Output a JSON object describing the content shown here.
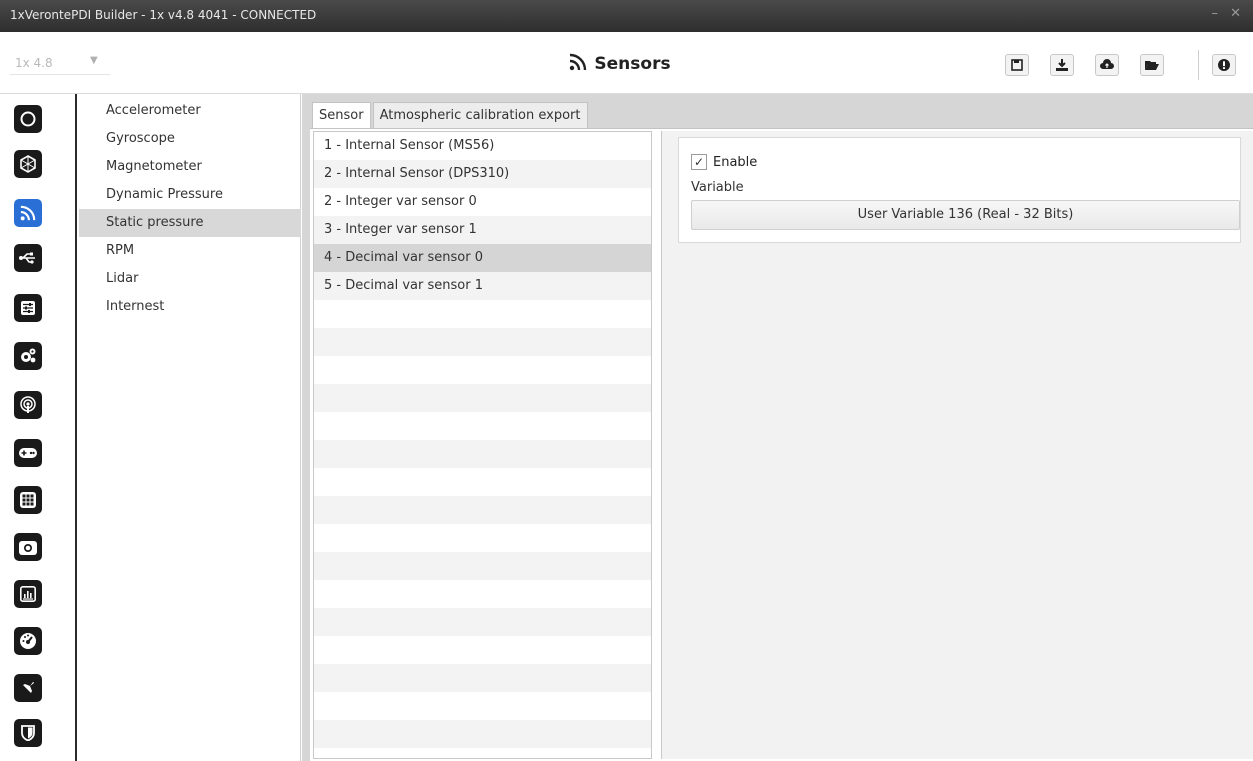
{
  "window": {
    "title": "1xVerontePDI Builder - 1x v4.8 4041 - CONNECTED",
    "controls": "– ✕"
  },
  "header": {
    "version": "1x 4.8",
    "title": "Sensors",
    "toolbar": [
      {
        "name": "save-icon",
        "glyph": "save"
      },
      {
        "name": "download-icon",
        "glyph": "download"
      },
      {
        "name": "cloud-upload-icon",
        "glyph": "cloud"
      },
      {
        "name": "folder-open-icon",
        "glyph": "folder"
      },
      {
        "name": "info-icon",
        "glyph": "info"
      }
    ]
  },
  "rail": {
    "items": [
      {
        "name": "power-icon",
        "active": false
      },
      {
        "name": "network-icon",
        "active": false
      },
      {
        "name": "sensors-icon",
        "active": true
      },
      {
        "name": "usb-icon",
        "active": false
      },
      {
        "name": "sliders-icon",
        "active": false
      },
      {
        "name": "gears-icon",
        "active": false
      },
      {
        "name": "podcast-icon",
        "active": false
      },
      {
        "name": "gamepad-icon",
        "active": false
      },
      {
        "name": "grid-icon",
        "active": false
      },
      {
        "name": "camera-icon",
        "active": false
      },
      {
        "name": "chart-icon",
        "active": false
      },
      {
        "name": "gauge-icon",
        "active": false
      },
      {
        "name": "plane-icon",
        "active": false
      },
      {
        "name": "shield-icon",
        "active": false
      }
    ],
    "active_color": "#2a6fd6"
  },
  "categories": [
    "Accelerometer",
    "Gyroscope",
    "Magnetometer",
    "Dynamic Pressure",
    "Static pressure",
    "RPM",
    "Lidar",
    "Internest"
  ],
  "selected_category": "Static pressure",
  "tabs": [
    {
      "label": "Sensor",
      "active": true
    },
    {
      "label": "Atmospheric calibration export",
      "active": false
    }
  ],
  "sensors": [
    "1 - Internal Sensor (MS56)",
    "2 - Internal Sensor (DPS310)",
    "2 - Integer var sensor 0",
    "3 - Integer var sensor 1",
    "4 - Decimal var sensor 0",
    "5 - Decimal var sensor 1"
  ],
  "selected_sensor": "4 - Decimal var sensor 0",
  "details": {
    "enable_label": "Enable",
    "enable_checked": true,
    "variable_label": "Variable",
    "variable_value": "User Variable 136 (Real - 32 Bits)"
  }
}
